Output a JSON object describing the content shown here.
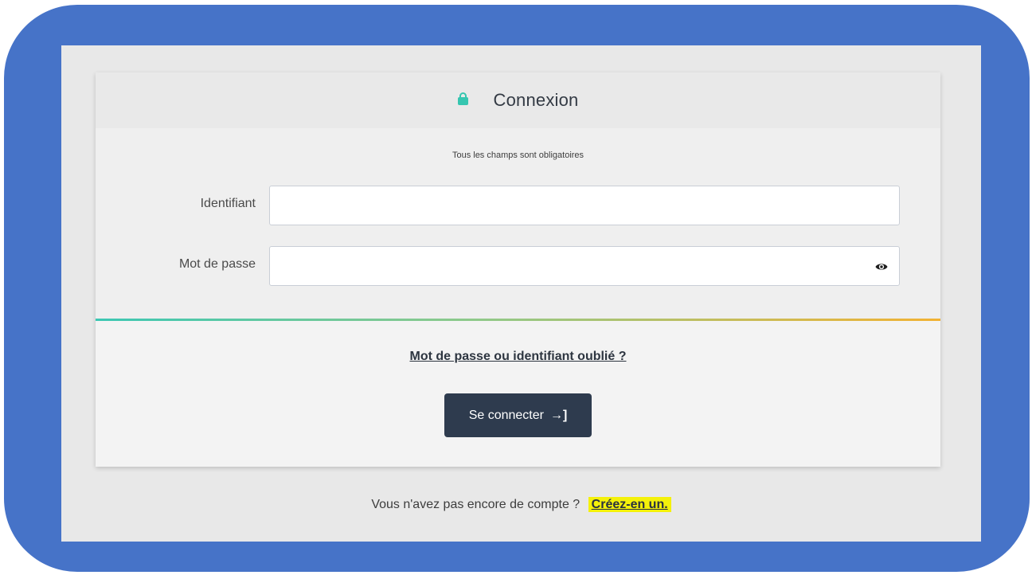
{
  "login_card": {
    "title": "Connexion",
    "required_note": "Tous les champs sont obligatoires",
    "username": {
      "label": "Identifiant",
      "value": "",
      "placeholder": ""
    },
    "password": {
      "label": "Mot de passe",
      "value": "",
      "placeholder": ""
    },
    "forgot_link": "Mot de passe ou identifiant oublié ?",
    "submit_label": "Se connecter",
    "submit_icon": "→]"
  },
  "signup": {
    "prompt": "Vous n'avez pas encore de compte ?",
    "link": "Créez-en un."
  },
  "icons": {
    "title_icon": "lock-icon",
    "password_toggle": "eye-icon",
    "submit_icon": "sign-in-icon"
  },
  "colors": {
    "frame": "#4673c8",
    "accent_lock": "#36c6b0",
    "button": "#2e3b4e",
    "highlight": "#f4f10a",
    "divider_start": "#3cc7b3",
    "divider_end": "#f2b233"
  }
}
